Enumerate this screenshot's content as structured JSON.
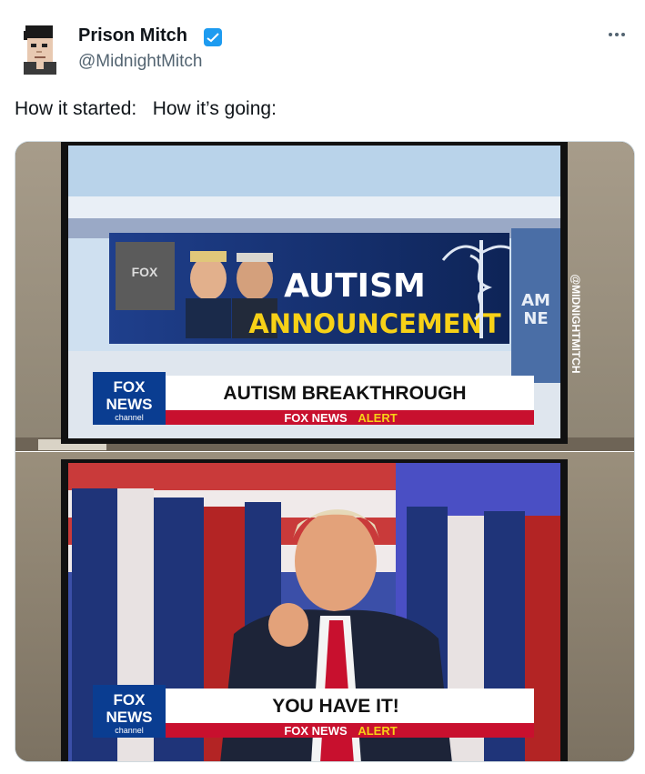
{
  "author": {
    "display_name": "Prison Mitch",
    "handle": "@MidnightMitch",
    "avatar_icon": "pixel-avatar-icon",
    "verified_icon": "verified-badge-icon"
  },
  "tweet": {
    "text": "How it started:   How it’s going:",
    "more_icon": "more-options-icon"
  },
  "media": {
    "top": {
      "headline_line1": "AUTISM",
      "headline_line2": "ANNOUNCEMENT",
      "chyron": "AUTISM BREAKTHROUGH",
      "alert_source": "FOX NEWS",
      "alert_word": "ALERT",
      "logo_line1": "FOX",
      "logo_line2": "NEWS",
      "logo_line3": "channel",
      "side_screen": "AM\nNE",
      "watermark": "@MIDNIGHTMITCH"
    },
    "bottom": {
      "chyron": "YOU HAVE IT!",
      "alert_source": "FOX NEWS",
      "alert_word": "ALERT",
      "logo_line1": "FOX",
      "logo_line2": "NEWS",
      "logo_line3": "channel"
    }
  },
  "colors": {
    "verified_blue": "#1d9bf0",
    "fox_red": "#c8102e",
    "fox_blue": "#0a3d91",
    "headline_yellow": "#f7d117"
  }
}
